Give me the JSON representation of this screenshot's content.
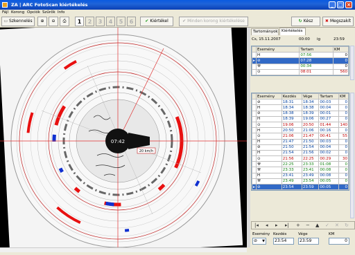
{
  "window": {
    "title": "ZA | ARC FotoScan kiértékelés",
    "controls": [
      "_",
      "□",
      "×"
    ]
  },
  "menu": [
    "Fájl",
    "Korong",
    "Opciók",
    "Szűrők",
    "Info"
  ],
  "toolbar": {
    "scan_label": "Szkennelés",
    "tabs": [
      "1",
      "2",
      "3",
      "4",
      "5",
      "6"
    ],
    "active_tab": "1",
    "evaluate_label": "Kiértékel",
    "evaluate_all_label": "Minden korong kiértékelése",
    "done_label": "Kész",
    "cancel_label": "Megszakít"
  },
  "chart": {
    "center_time": "07:42",
    "speed_label": "20 km/h"
  },
  "panel": {
    "tabs": [
      "Tartományok",
      "Kiértékelés"
    ],
    "active_tab": "Kiértékelés",
    "date": "Cs, 15.11.2007",
    "time_from": "00:00",
    "time_sep": "ig",
    "time_to": "23:59",
    "summary": {
      "columns": [
        "Esemény",
        "Tartam",
        "KM"
      ],
      "rows": [
        {
          "event": "H",
          "time": "07:56",
          "km": "0"
        },
        {
          "event": "⊘",
          "time": "07:28",
          "km": "0",
          "selected": true
        },
        {
          "event": "⚒",
          "time": "00:34",
          "km": "0"
        },
        {
          "event": "⊙",
          "time": "08:01",
          "km": "560"
        }
      ]
    },
    "events": {
      "columns": [
        "Esemény",
        "Kezdés",
        "Vége",
        "Tartam",
        "KM"
      ],
      "rows": [
        {
          "event": "⊘",
          "start": "18:31",
          "end": "18:34",
          "dur": "00:03",
          "km": "0"
        },
        {
          "event": "H",
          "start": "18:34",
          "end": "18:38",
          "dur": "00:04",
          "km": "0"
        },
        {
          "event": "⊘",
          "start": "18:38",
          "end": "18:39",
          "dur": "00:01",
          "km": "0"
        },
        {
          "event": "H",
          "start": "18:39",
          "end": "19:06",
          "dur": "00:27",
          "km": "0"
        },
        {
          "event": "⊙",
          "start": "19:06",
          "end": "20:50",
          "dur": "01:44",
          "km": "140"
        },
        {
          "event": "H",
          "start": "20:50",
          "end": "21:06",
          "dur": "00:16",
          "km": "0"
        },
        {
          "event": "⊙",
          "start": "21:06",
          "end": "21:47",
          "dur": "00:41",
          "km": "55"
        },
        {
          "event": "H",
          "start": "21:47",
          "end": "21:50",
          "dur": "00:03",
          "km": "0"
        },
        {
          "event": "⊘",
          "start": "21:50",
          "end": "21:54",
          "dur": "00:04",
          "km": "0"
        },
        {
          "event": "H",
          "start": "21:54",
          "end": "21:56",
          "dur": "00:02",
          "km": "0"
        },
        {
          "event": "⊙",
          "start": "21:56",
          "end": "22:25",
          "dur": "00:29",
          "km": "30"
        },
        {
          "event": "⚒",
          "start": "22:25",
          "end": "23:33",
          "dur": "01:08",
          "km": "0"
        },
        {
          "event": "⚒",
          "start": "23:33",
          "end": "23:41",
          "dur": "00:08",
          "km": "0"
        },
        {
          "event": "H",
          "start": "23:41",
          "end": "23:49",
          "dur": "00:08",
          "km": "0"
        },
        {
          "event": "⚒",
          "start": "23:49",
          "end": "23:54",
          "dur": "00:05",
          "km": "0"
        },
        {
          "event": "⊘",
          "start": "23:54",
          "end": "23:59",
          "dur": "00:05",
          "km": "0",
          "selected": true
        }
      ]
    },
    "nav": [
      "|◂",
      "◂",
      "▸",
      "▸|",
      "+",
      "−",
      "▲",
      "✓",
      "✕",
      "↻"
    ],
    "editor": {
      "event_label": "Esemény",
      "start_label": "Kezdés",
      "end_label": "Vége",
      "km_label": "KM",
      "event_value": "⊘",
      "start_value": "23:54",
      "end_value": "23:59",
      "km_value": "0"
    }
  },
  "colors": {
    "title_blue": "#1f64d8",
    "selection": "#3169c6",
    "chart_red": "#e81010",
    "chart_blue": "#1030d0"
  }
}
